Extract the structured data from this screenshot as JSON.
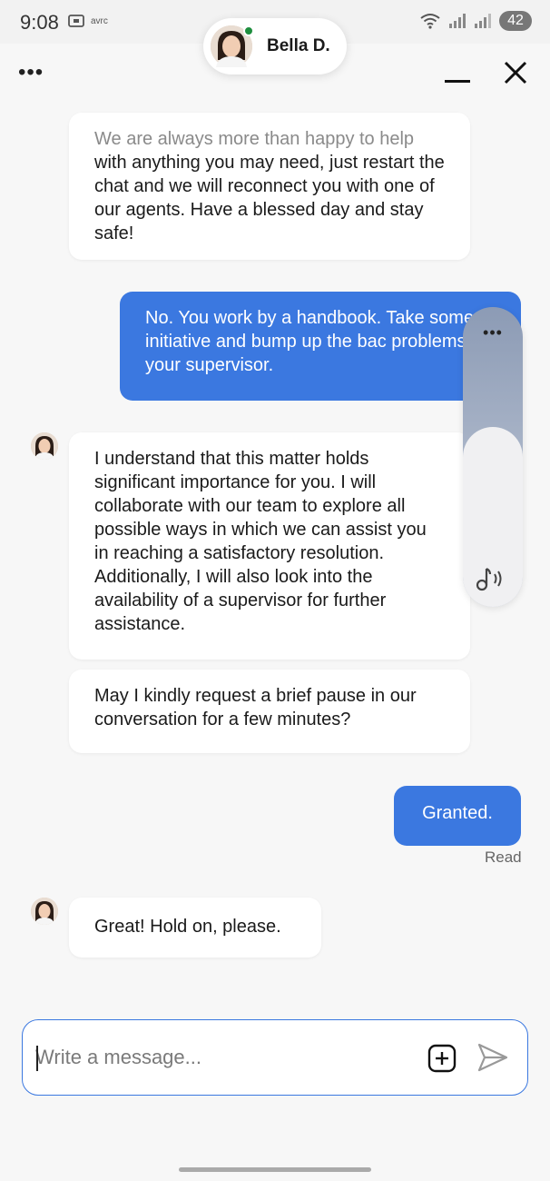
{
  "status_bar": {
    "time": "9:08",
    "carrier_tag": "avrc",
    "battery": "42"
  },
  "header": {
    "agent_name": "Bella D.",
    "menu_icon": "more-dots-icon",
    "minimize_icon": "minimize-icon",
    "close_icon": "close-icon"
  },
  "messages": [
    {
      "sender": "agent",
      "faded_line": "We are always more than happy to help",
      "text": "with anything you may need, just restart the chat and we will reconnect you with one of our agents. Have a blessed day and stay safe!"
    },
    {
      "sender": "user",
      "text": "No. You work by a handbook. Take some initiative and bump up the bac problems to your supervisor."
    },
    {
      "sender": "agent",
      "text": "I understand that this matter holds significant importance for you. I will collaborate with our team to explore all possible ways in which we can assist you in reaching a satisfactory resolution. Additionally, I will also look into the availability of a supervisor for further assistance."
    },
    {
      "sender": "agent",
      "text": "May I kindly request a brief pause in our conversation for a few minutes?"
    },
    {
      "sender": "user",
      "text": "Granted.",
      "status": "Read"
    },
    {
      "sender": "agent",
      "text": "Great! Hold on, please."
    }
  ],
  "volume_overlay": {
    "level": 0.6,
    "icon": "music-note-sound-icon"
  },
  "composer": {
    "placeholder": "Write a message...",
    "value": ""
  },
  "colors": {
    "user_bubble": "#3b78e0",
    "online_status": "#1e8e3e",
    "background": "#f7f7f7"
  }
}
